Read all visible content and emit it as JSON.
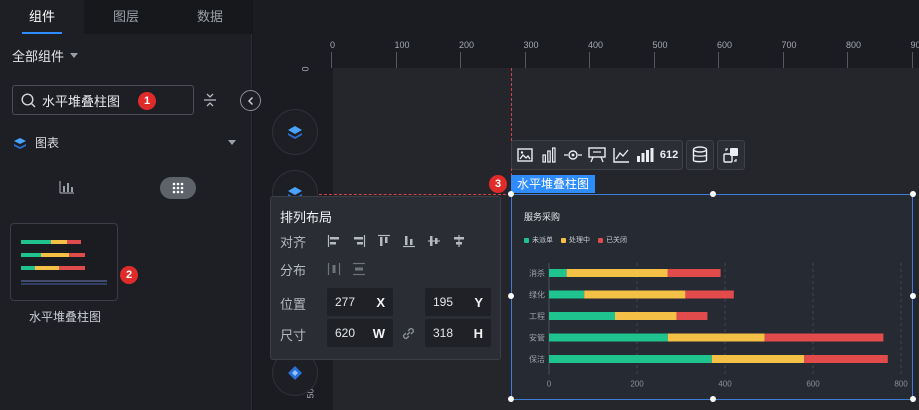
{
  "tabs": [
    {
      "label": "组件",
      "active": true
    },
    {
      "label": "图层",
      "active": false
    },
    {
      "label": "数据",
      "active": false
    }
  ],
  "filter": {
    "all_components": "全部组件"
  },
  "search": {
    "value": "水平堆叠柱图",
    "badge": "1"
  },
  "category": {
    "label": "图表"
  },
  "component_card": {
    "label": "水平堆叠柱图",
    "badge": "2"
  },
  "ruler": {
    "top_ticks": [
      "0",
      "100",
      "200",
      "300",
      "400",
      "500",
      "600",
      "700",
      "800",
      "900"
    ],
    "left_ticks": [
      "0",
      "100",
      "500"
    ]
  },
  "selection": {
    "tag": "水平堆叠柱图",
    "badge": "3"
  },
  "toolbar": {
    "number_icon": "612"
  },
  "layout_panel": {
    "title": "排列布局",
    "align_label": "对齐",
    "distribute_label": "分布",
    "position_label": "位置",
    "size_label": "尺寸",
    "x_value": "277",
    "x_unit": "X",
    "y_value": "195",
    "y_unit": "Y",
    "w_value": "620",
    "w_unit": "W",
    "h_value": "318",
    "h_unit": "H"
  },
  "colors": {
    "accent": "#2f8cff",
    "series1": "#1fc38e",
    "series2": "#f5c046",
    "series3": "#e24b4b",
    "badge": "#e02b2b"
  },
  "chart_data": {
    "type": "bar",
    "orientation": "horizontal",
    "stacked": true,
    "title": "服务采购",
    "categories": [
      "消杀",
      "绿化",
      "工程",
      "安管",
      "保洁"
    ],
    "series": [
      {
        "name": "未派单",
        "values": [
          40,
          80,
          150,
          270,
          370
        ]
      },
      {
        "name": "处理中",
        "values": [
          230,
          230,
          140,
          220,
          210
        ]
      },
      {
        "name": "已关闭",
        "values": [
          120,
          110,
          70,
          270,
          190
        ]
      }
    ],
    "xticks": [
      "0",
      "200",
      "400",
      "600",
      "800"
    ],
    "xlim": [
      0,
      800
    ],
    "legend": "top-left",
    "grid": true
  }
}
